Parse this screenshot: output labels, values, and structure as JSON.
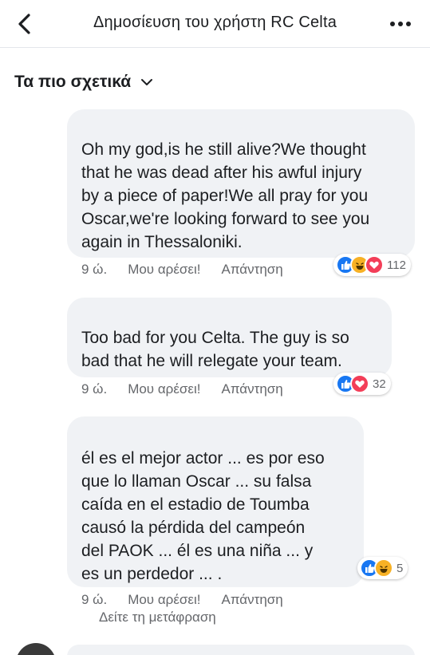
{
  "header": {
    "title": "Δημοσίευση του χρήστη RC Celta"
  },
  "sort": {
    "label": "Τα πιο σχετικά"
  },
  "colors": {
    "like_blue": "#1877f2",
    "love_red": "#f33e58",
    "haha_yellow": "#f7b125",
    "meta_grey": "#65676b",
    "bubble_bg": "#f0f2f5"
  },
  "comments": [
    {
      "lines": [
        "Oh my god,is he still alive?We thought",
        "that he was dead after his awful injury",
        "by a piece of paper!We all pray for you",
        "Oscar,we're looking forward to see you",
        "again in Thessaloniki."
      ],
      "time": "9 ώ.",
      "like_label": "Μου αρέσει!",
      "reply_label": "Απάντηση",
      "reactions": [
        "like-icon",
        "haha-icon",
        "love-icon"
      ],
      "reaction_count": "112"
    },
    {
      "lines": [
        "Too bad for you Celta. The guy is so",
        "bad that he will relegate your team."
      ],
      "time": "9 ώ.",
      "like_label": "Μου αρέσει!",
      "reply_label": "Απάντηση",
      "reactions": [
        "like-icon",
        "love-icon"
      ],
      "reaction_count": "32"
    },
    {
      "lines": [
        "él es el mejor actor ... es por eso",
        "que lo llaman Oscar ... su falsa",
        "caída en el estadio de Toumba",
        "causó la pérdida del campeón",
        "del PAOK ... él es una niña ... y",
        "es un perdedor ... ."
      ],
      "time": "9 ώ.",
      "like_label": "Μου αρέσει!",
      "reply_label": "Απάντηση",
      "reactions": [
        "like-icon",
        "haha-icon"
      ],
      "reaction_count": "5",
      "translate_label": "Δείτε τη μετάφραση"
    }
  ]
}
